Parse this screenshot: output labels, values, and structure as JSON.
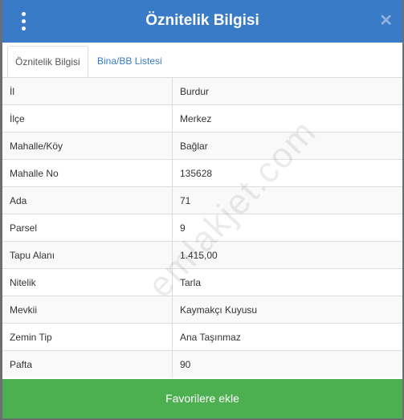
{
  "header": {
    "title": "Öznitelik Bilgisi",
    "close_label": "✕"
  },
  "tabs": [
    {
      "label": "Öznitelik Bilgisi",
      "active": true
    },
    {
      "label": "Bina/BB Listesi",
      "active": false
    }
  ],
  "attributes": [
    {
      "key": "İl",
      "value": "Burdur"
    },
    {
      "key": "İlçe",
      "value": "Merkez"
    },
    {
      "key": "Mahalle/Köy",
      "value": "Bağlar"
    },
    {
      "key": "Mahalle No",
      "value": "135628"
    },
    {
      "key": "Ada",
      "value": "71"
    },
    {
      "key": "Parsel",
      "value": "9"
    },
    {
      "key": "Tapu Alanı",
      "value": "1.415,00"
    },
    {
      "key": "Nitelik",
      "value": "Tarla"
    },
    {
      "key": "Mevkii",
      "value": "Kaymakçı Kuyusu"
    },
    {
      "key": "Zemin Tip",
      "value": "Ana Taşınmaz"
    },
    {
      "key": "Pafta",
      "value": "90"
    }
  ],
  "watermark": "emlakjet.com",
  "footer": {
    "favorite_label": "Favorilere ekle"
  },
  "colors": {
    "header": "#3a7bc8",
    "button": "#4caf50",
    "tab_link": "#3a7bc8"
  }
}
